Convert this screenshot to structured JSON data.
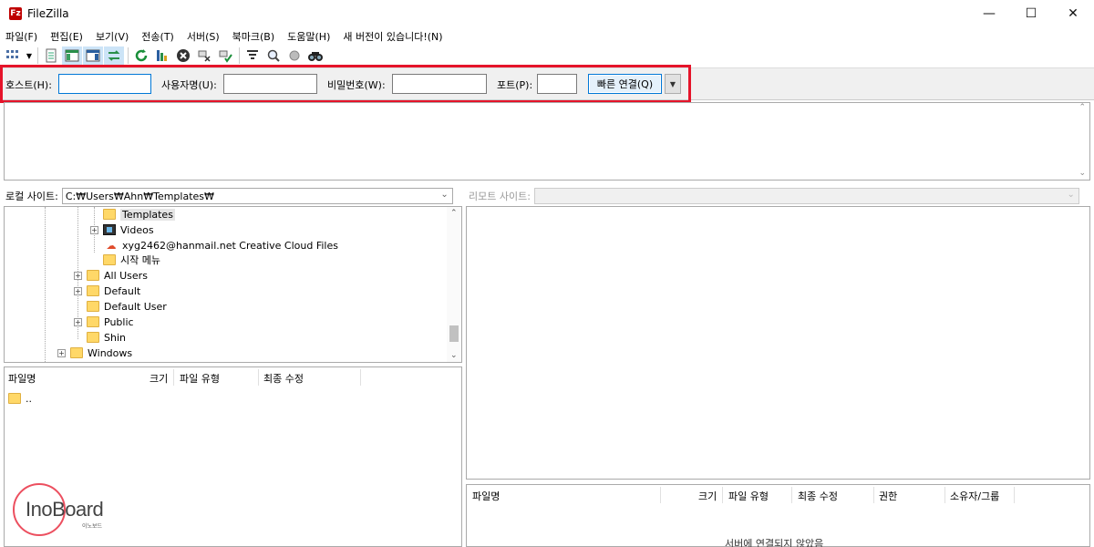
{
  "window": {
    "title": "FileZilla",
    "app_icon": "Fz",
    "minimize": "—",
    "maximize": "☐",
    "close": "✕"
  },
  "menu": [
    "파일(F)",
    "편집(E)",
    "보기(V)",
    "전송(T)",
    "서버(S)",
    "북마크(B)",
    "도움말(H)",
    "새 버전이 있습니다!(N)"
  ],
  "toolbar": {
    "icons": [
      "site-manager-icon",
      "dropdown-arrow-icon",
      "toggle-log-icon",
      "toggle-local-tree-icon",
      "toggle-remote-tree-icon",
      "toggle-queue-icon",
      "refresh-icon",
      "process-queue-icon",
      "cancel-icon",
      "disconnect-icon",
      "reconnect-icon",
      "filter-icon",
      "search-icon",
      "compare-icon",
      "find-icon"
    ]
  },
  "quickconnect": {
    "host_label": "호스트(H):",
    "user_label": "사용자명(U):",
    "pass_label": "비밀번호(W):",
    "port_label": "포트(P):",
    "host_value": "",
    "user_value": "",
    "pass_value": "",
    "port_value": "",
    "connect_button": "빠른 연결(Q)",
    "highlight_color": "#e5142a"
  },
  "local": {
    "site_label": "로컬 사이트:",
    "path": "C:₩Users₩Ahn₩Templates₩",
    "tree": [
      {
        "label": "Templates",
        "type": "folder",
        "selected": true
      },
      {
        "label": "Videos",
        "type": "video",
        "expandable": true
      },
      {
        "label": "xyg2462@hanmail.net Creative Cloud Files",
        "type": "cc"
      },
      {
        "label": "시작 메뉴",
        "type": "folder"
      },
      {
        "label": "All Users",
        "type": "folder",
        "expandable": true
      },
      {
        "label": "Default",
        "type": "folder",
        "expandable": true
      },
      {
        "label": "Default User",
        "type": "folder"
      },
      {
        "label": "Public",
        "type": "folder",
        "expandable": true
      },
      {
        "label": "Shin",
        "type": "folder"
      },
      {
        "label": "Windows",
        "type": "folder",
        "expandable": true
      }
    ],
    "columns": [
      "파일명",
      "크기",
      "파일 유형",
      "최종 수정"
    ],
    "rows": [
      {
        "name": ".."
      }
    ]
  },
  "remote": {
    "site_label": "리모트 사이트:",
    "path": "",
    "columns": [
      "파일명",
      "크기",
      "파일 유형",
      "최종 수정",
      "권한",
      "소유자/그룹"
    ],
    "status": "서버에 연결되지 않았음"
  },
  "watermark": {
    "brand": "InoBoard",
    "sub": "이노보드"
  }
}
